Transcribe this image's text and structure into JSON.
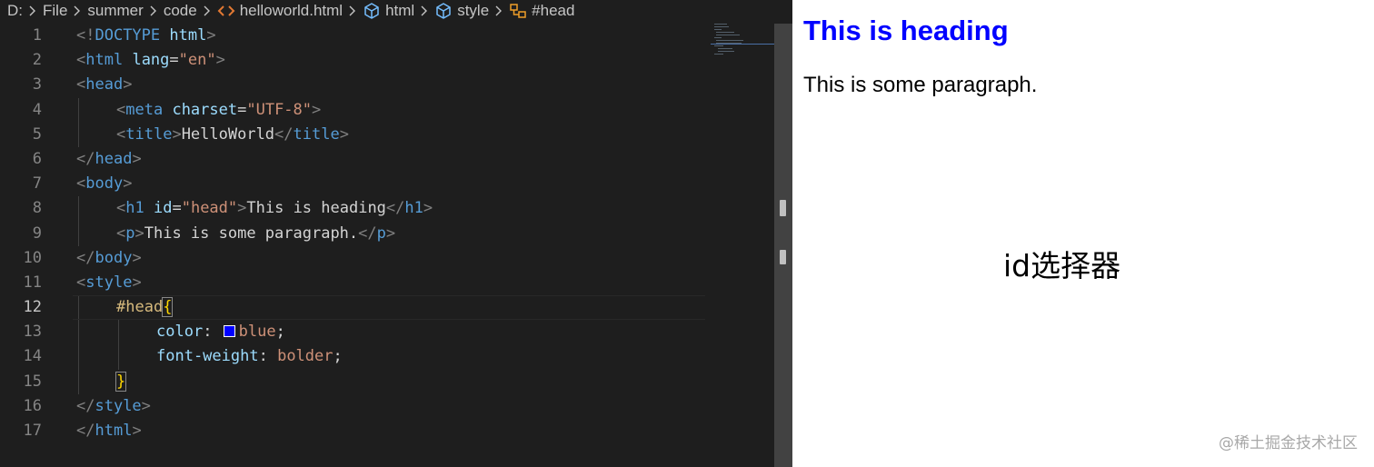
{
  "breadcrumb": {
    "drive": "D:",
    "folders": [
      "File",
      "summer",
      "code"
    ],
    "file": "helloworld.html",
    "symbols": [
      "html",
      "style",
      "#head"
    ],
    "file_icon": "html-file-icon",
    "symbol_icon": "cube-icon",
    "selector_icon": "css-selector-icon"
  },
  "editor": {
    "active_line": 12,
    "lines": [
      {
        "n": "1",
        "tokens": [
          [
            "br",
            "<!"
          ],
          [
            "tag",
            "DOCTYPE"
          ],
          [
            "txt",
            " "
          ],
          [
            "attr",
            "html"
          ],
          [
            "br",
            ">"
          ]
        ]
      },
      {
        "n": "2",
        "tokens": [
          [
            "br",
            "<"
          ],
          [
            "tag",
            "html"
          ],
          [
            "txt",
            " "
          ],
          [
            "attr",
            "lang"
          ],
          [
            "txt",
            "="
          ],
          [
            "str",
            "\"en\""
          ],
          [
            "br",
            ">"
          ]
        ]
      },
      {
        "n": "3",
        "tokens": [
          [
            "br",
            "<"
          ],
          [
            "tag",
            "head"
          ],
          [
            "br",
            ">"
          ]
        ]
      },
      {
        "n": "4",
        "indent": 1,
        "tokens": [
          [
            "br",
            "<"
          ],
          [
            "tag",
            "meta"
          ],
          [
            "txt",
            " "
          ],
          [
            "attr",
            "charset"
          ],
          [
            "txt",
            "="
          ],
          [
            "str",
            "\"UTF-8\""
          ],
          [
            "br",
            ">"
          ]
        ]
      },
      {
        "n": "5",
        "indent": 1,
        "tokens": [
          [
            "br",
            "<"
          ],
          [
            "tag",
            "title"
          ],
          [
            "br",
            ">"
          ],
          [
            "txt",
            "HelloWorld"
          ],
          [
            "br",
            "</"
          ],
          [
            "tag",
            "title"
          ],
          [
            "br",
            ">"
          ]
        ]
      },
      {
        "n": "6",
        "tokens": [
          [
            "br",
            "</"
          ],
          [
            "tag",
            "head"
          ],
          [
            "br",
            ">"
          ]
        ]
      },
      {
        "n": "7",
        "tokens": [
          [
            "br",
            "<"
          ],
          [
            "tag",
            "body"
          ],
          [
            "br",
            ">"
          ]
        ]
      },
      {
        "n": "8",
        "indent": 1,
        "tokens": [
          [
            "br",
            "<"
          ],
          [
            "tag",
            "h1"
          ],
          [
            "txt",
            " "
          ],
          [
            "attr",
            "id"
          ],
          [
            "txt",
            "="
          ],
          [
            "str",
            "\"head\""
          ],
          [
            "br",
            ">"
          ],
          [
            "txt",
            "This is heading"
          ],
          [
            "br",
            "</"
          ],
          [
            "tag",
            "h1"
          ],
          [
            "br",
            ">"
          ]
        ]
      },
      {
        "n": "9",
        "indent": 1,
        "tokens": [
          [
            "br",
            "<"
          ],
          [
            "tag",
            "p"
          ],
          [
            "br",
            ">"
          ],
          [
            "txt",
            "This is some paragraph."
          ],
          [
            "br",
            "</"
          ],
          [
            "tag",
            "p"
          ],
          [
            "br",
            ">"
          ]
        ]
      },
      {
        "n": "10",
        "tokens": [
          [
            "br",
            "</"
          ],
          [
            "tag",
            "body"
          ],
          [
            "br",
            ">"
          ]
        ]
      },
      {
        "n": "11",
        "tokens": [
          [
            "br",
            "<"
          ],
          [
            "tag",
            "style"
          ],
          [
            "br",
            ">"
          ]
        ]
      },
      {
        "n": "12",
        "indent": 1,
        "tokens": [
          [
            "sel",
            "#head"
          ],
          [
            "brace-hl",
            "{"
          ]
        ]
      },
      {
        "n": "13",
        "indent": 2,
        "tokens": [
          [
            "prop",
            "color"
          ],
          [
            "txt",
            ": "
          ],
          [
            "swatch",
            "#0000ff"
          ],
          [
            "val",
            "blue"
          ],
          [
            "txt",
            ";"
          ]
        ]
      },
      {
        "n": "14",
        "indent": 2,
        "tokens": [
          [
            "prop",
            "font-weight"
          ],
          [
            "txt",
            ": "
          ],
          [
            "val",
            "bolder"
          ],
          [
            "txt",
            ";"
          ]
        ]
      },
      {
        "n": "15",
        "indent": 1,
        "tokens": [
          [
            "brace-hl",
            "}"
          ]
        ]
      },
      {
        "n": "16",
        "tokens": [
          [
            "br",
            "</"
          ],
          [
            "tag",
            "style"
          ],
          [
            "br",
            ">"
          ]
        ]
      },
      {
        "n": "17",
        "tokens": [
          [
            "br",
            "</"
          ],
          [
            "tag",
            "html"
          ],
          [
            "br",
            ">"
          ]
        ]
      }
    ]
  },
  "preview": {
    "heading": "This is heading",
    "paragraph": "This is some paragraph.",
    "caption": "id选择器",
    "watermark": "@稀土掘金技术社区",
    "heading_color": "#0000ff"
  },
  "colors": {
    "editor_bg": "#1e1e1e",
    "tag": "#569cd6",
    "attribute": "#9cdcfe",
    "string": "#ce9178",
    "selector": "#d7ba7d",
    "brace": "#ffd700"
  }
}
